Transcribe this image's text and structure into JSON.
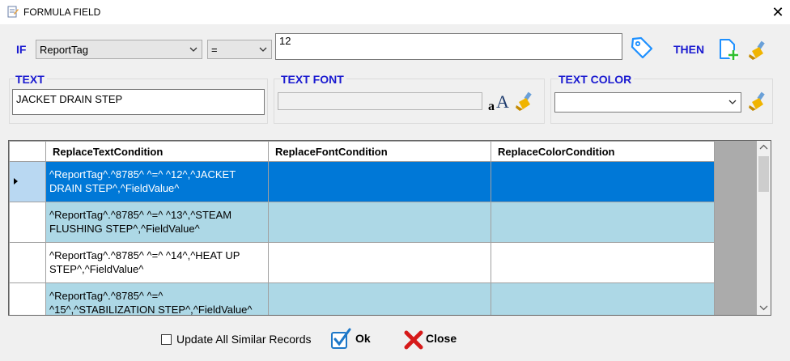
{
  "window": {
    "title": "FORMULA FIELD",
    "close_symbol": "✕"
  },
  "condition": {
    "if_label": "IF",
    "field_value": "ReportTag",
    "operator_value": "=",
    "value_text": "12",
    "then_label": "THEN"
  },
  "text_group": {
    "label": "TEXT",
    "value": "JACKET DRAIN STEP"
  },
  "font_group": {
    "label": "TEXT FONT",
    "value": ""
  },
  "color_group": {
    "label": "TEXT COLOR",
    "value": ""
  },
  "grid": {
    "columns": [
      "ReplaceTextCondition",
      "ReplaceFontCondition",
      "ReplaceColorCondition"
    ],
    "rows": [
      {
        "text": "^ReportTag^.^8785^ ^=^ ^12^,^JACKET DRAIN STEP^,^FieldValue^",
        "font": "",
        "color": "",
        "state": "selected"
      },
      {
        "text": "^ReportTag^.^8785^ ^=^ ^13^,^STEAM FLUSHING STEP^,^FieldValue^",
        "font": "",
        "color": "",
        "state": "alt"
      },
      {
        "text": "^ReportTag^.^8785^ ^=^ ^14^,^HEAT UP STEP^,^FieldValue^",
        "font": "",
        "color": "",
        "state": "normal"
      },
      {
        "text": "^ReportTag^.^8785^ ^=^ ^15^,^STABILIZATION STEP^,^FieldValue^",
        "font": "",
        "color": "",
        "state": "alt"
      }
    ]
  },
  "footer": {
    "update_all_label": "Update All Similar Records",
    "update_all_checked": false,
    "ok_label": "Ok",
    "close_label": "Close"
  },
  "colors": {
    "label_blue": "#1a1ad0",
    "selected_row": "#0078d7",
    "alt_row": "#add8e6",
    "icon_blue": "#1e90ff"
  }
}
